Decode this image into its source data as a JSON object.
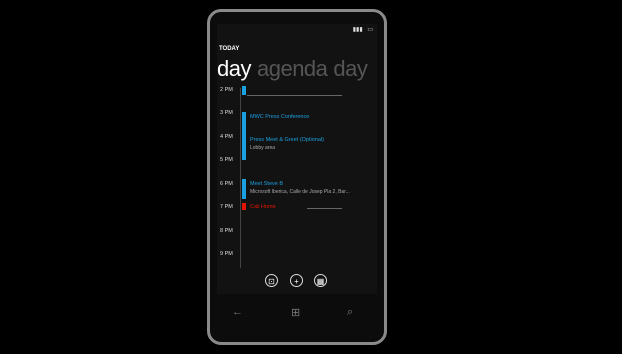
{
  "status": {
    "signal": "▮▮▮",
    "battery": "▭"
  },
  "header": {
    "date": "TODAY"
  },
  "pivot": {
    "tabs": [
      "day",
      "agenda",
      "day"
    ]
  },
  "hours": [
    "2 PM",
    "3 PM",
    "4 PM",
    "5 PM",
    "6 PM",
    "7 PM",
    "8 PM",
    "9 PM"
  ],
  "events": [
    {
      "title": "MWC Press Conference",
      "color": "#1ba1e2"
    },
    {
      "title": "Press Meet & Greet (Optional)",
      "subtitle": "Lobby area",
      "color": "#1ba1e2"
    },
    {
      "title": "Meet Steve B",
      "subtitle": "Microsoft Iberica, Calle de Josep Pla 2, Bar...",
      "color": "#1ba1e2"
    },
    {
      "title": "Cali Home",
      "color": "#e51400"
    }
  ],
  "appbar": {
    "buttons": [
      "today-icon",
      "add-icon",
      "month-icon"
    ],
    "glyphs": [
      "⊡",
      "+",
      "▦"
    ]
  },
  "hardware": {
    "back": "←",
    "start": "⊞",
    "search": "⌕"
  }
}
